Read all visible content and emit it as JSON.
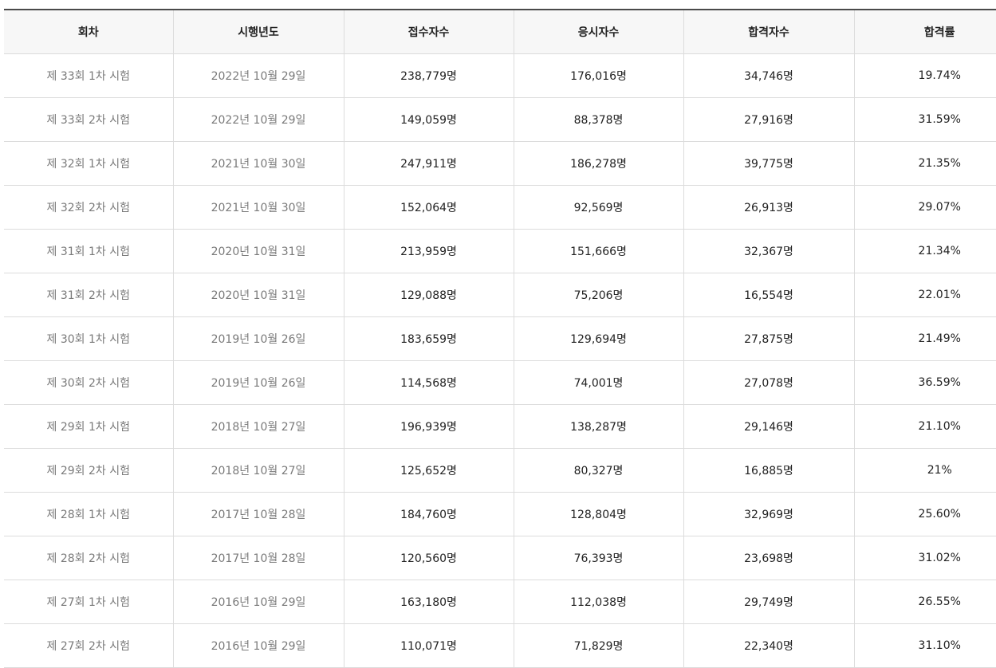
{
  "table": {
    "headers": [
      "회차",
      "시행년도",
      "접수자수",
      "응시자수",
      "합격자수",
      "합격률"
    ],
    "rows": [
      [
        "제 33회 1차 시험",
        "2022년 10월 29일",
        "238,779명",
        "176,016명",
        "34,746명",
        "19.74%"
      ],
      [
        "제 33회 2차 시험",
        "2022년 10월 29일",
        "149,059명",
        "88,378명",
        "27,916명",
        "31.59%"
      ],
      [
        "제 32회 1차 시험",
        "2021년 10월 30일",
        "247,911명",
        "186,278명",
        "39,775명",
        "21.35%"
      ],
      [
        "제 32회 2차 시험",
        "2021년 10월 30일",
        "152,064명",
        "92,569명",
        "26,913명",
        "29.07%"
      ],
      [
        "제 31회 1차 시험",
        "2020년 10월 31일",
        "213,959명",
        "151,666명",
        "32,367명",
        "21.34%"
      ],
      [
        "제 31회 2차 시험",
        "2020년 10월 31일",
        "129,088명",
        "75,206명",
        "16,554명",
        "22.01%"
      ],
      [
        "제 30회 1차 시험",
        "2019년 10월 26일",
        "183,659명",
        "129,694명",
        "27,875명",
        "21.49%"
      ],
      [
        "제 30회 2차 시험",
        "2019년 10월 26일",
        "114,568명",
        "74,001명",
        "27,078명",
        "36.59%"
      ],
      [
        "제 29회 1차 시험",
        "2018년 10월 27일",
        "196,939명",
        "138,287명",
        "29,146명",
        "21.10%"
      ],
      [
        "제 29회 2차 시험",
        "2018년 10월 27일",
        "125,652명",
        "80,327명",
        "16,885명",
        "21%"
      ],
      [
        "제 28회 1차 시험",
        "2017년 10월 28일",
        "184,760명",
        "128,804명",
        "32,969명",
        "25.60%"
      ],
      [
        "제 28회 2차 시험",
        "2017년 10월 28일",
        "120,560명",
        "76,393명",
        "23,698명",
        "31.02%"
      ],
      [
        "제 27회 1차 시험",
        "2016년 10월 29일",
        "163,180명",
        "112,038명",
        "29,749명",
        "26.55%"
      ],
      [
        "제 27회 2차 시험",
        "2016년 10월 29일",
        "110,071명",
        "71,829명",
        "22,340명",
        "31.10%"
      ]
    ]
  }
}
